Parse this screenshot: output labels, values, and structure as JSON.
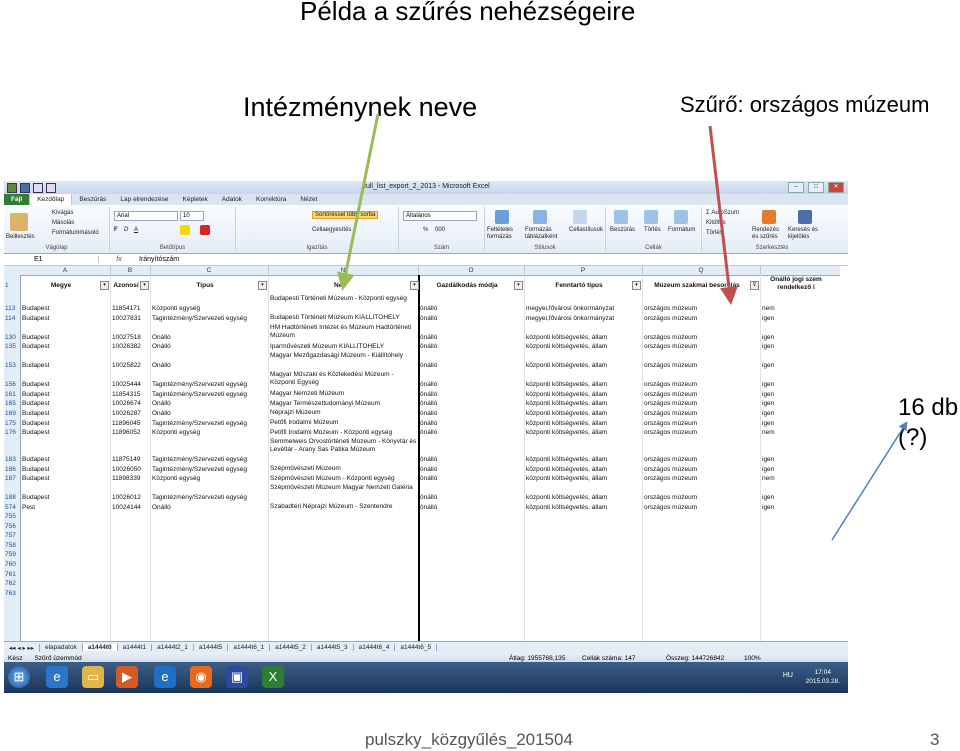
{
  "slide": {
    "title": "Példa a szűrés nehézségeire",
    "annotation_name": "Intézménynek neve",
    "annotation_filter": "Szűrő: országos múzeum",
    "annotation_count_line1": "16 db",
    "annotation_count_line2": "(?)",
    "footer": "pulszky_közgyűlés_201504",
    "page_number": "3"
  },
  "window": {
    "title": "full_list_export_2_2013 - Microsoft Excel"
  },
  "ribbon": {
    "tabs": [
      "Fájl",
      "Kezdőlap",
      "Beszúrás",
      "Lap elrendezése",
      "Képletek",
      "Adatok",
      "Korrektúra",
      "Nézet"
    ],
    "clipboard": {
      "paste": "Beillesztés",
      "cut": "Kivágás",
      "copy": "Másolás",
      "format_painter": "Formátummásoló",
      "label": "Vágólap"
    },
    "font": {
      "name": "Arial",
      "size": "10",
      "label": "Betűtípus"
    },
    "alignment": {
      "wrap": "Sortöréssel több sorba",
      "merge": "Cellaegyesítés",
      "label": "Igazítás"
    },
    "number": {
      "format": "Általános",
      "percent": "%",
      "thousands": "000",
      "label": "Szám"
    },
    "styles": {
      "conditional": "Feltételes formázás",
      "as_table": "Formázás táblázatként",
      "cell_styles": "Cellastílusok",
      "label": "Stílusok"
    },
    "cells": {
      "insert": "Beszúrás",
      "delete": "Törlés",
      "format": "Formátum",
      "label": "Cellák"
    },
    "editing": {
      "autosum": "AutoSzum",
      "fill": "Kitöltés",
      "clear": "Törlés",
      "sort": "Rendezés és szűrés",
      "find": "Keresés és kijelölés",
      "label": "Szerkesztés"
    }
  },
  "formula_bar": {
    "name_box": "E1",
    "fx": "fx",
    "content": "Irányítószám"
  },
  "columns": [
    "A",
    "B",
    "C",
    "N",
    "O",
    "P",
    "Q"
  ],
  "header_row": {
    "row": "1",
    "cells": [
      "Megye",
      "Azonosí",
      "Típus",
      "Név",
      "Gazdálkodás módja",
      "Fenntartó típus",
      "Múzeum szakmai besorolás",
      "Önálló jogi szem rendelkező i"
    ]
  },
  "rows": [
    {
      "row": "113",
      "megye": "Budapest",
      "azon": "11854171",
      "tipus": "Központi egység",
      "nev": "Budapesti Történeti Múzeum - Központi egység",
      "gazd": "önálló",
      "fenn": "megyei,fővárosi önkormányzat",
      "besor": "országos múzeum",
      "onallo": "nem"
    },
    {
      "row": "114",
      "megye": "Budapest",
      "azon": "10027831",
      "tipus": "Tagintézmény/Szervezeti egység",
      "nev": "Budapesti Történeti Múzeum KIÁLLÍTÓHELY",
      "gazd": "önálló",
      "fenn": "megyei,fővárosi önkormányzat",
      "besor": "országos múzeum",
      "onallo": "igen"
    },
    {
      "row": "130",
      "megye": "Budapest",
      "azon": "10027518",
      "tipus": "Önálló",
      "nev": "HM Hadtörténeti Intézet és Múzeum Hadtörténeti Múzeum",
      "gazd": "önálló",
      "fenn": "központi költségvetés, állam",
      "besor": "országos múzeum",
      "onallo": "igen"
    },
    {
      "row": "135",
      "megye": "Budapest",
      "azon": "10026382",
      "tipus": "Önálló",
      "nev": "Iparművészeti Múzeum KIÁLLÍTÓHELY",
      "gazd": "önálló",
      "fenn": "központi költségvetés, állam",
      "besor": "országos múzeum",
      "onallo": "igen"
    },
    {
      "row": "153",
      "megye": "Budapest",
      "azon": "10025822",
      "tipus": "Önálló",
      "nev": "Magyar Mezőgazdasági Múzeum - Kiállítóhely",
      "gazd": "önálló",
      "fenn": "központi költségvetés, állam",
      "besor": "országos múzeum",
      "onallo": "igen"
    },
    {
      "row": "156",
      "megye": "Budapest",
      "azon": "10025444",
      "tipus": "Tagintézmény/Szervezeti egység",
      "nev": "Magyar Műszaki és Közlekedési Múzeum - Központi Egység",
      "gazd": "önálló",
      "fenn": "központi költségvetés, állam",
      "besor": "országos múzeum",
      "onallo": "igen"
    },
    {
      "row": "161",
      "megye": "Budapest",
      "azon": "11854315",
      "tipus": "Tagintézmény/Szervezeti egység",
      "nev": "Magyar Nemzeti Múzeum",
      "gazd": "önálló",
      "fenn": "központi költségvetés, állam",
      "besor": "országos múzeum",
      "onallo": "igen"
    },
    {
      "row": "165",
      "megye": "Budapest",
      "azon": "10026674",
      "tipus": "Önálló",
      "nev": "Magyar Természettudományi Múzeum",
      "gazd": "önálló",
      "fenn": "központi költségvetés, állam",
      "besor": "országos múzeum",
      "onallo": "igen"
    },
    {
      "row": "169",
      "megye": "Budapest",
      "azon": "10026287",
      "tipus": "Önálló",
      "nev": "Néprajzi Múzeum",
      "gazd": "önálló",
      "fenn": "központi költségvetés, állam",
      "besor": "országos múzeum",
      "onallo": "igen"
    },
    {
      "row": "175",
      "megye": "Budapest",
      "azon": "11896045",
      "tipus": "Tagintézmény/Szervezeti egység",
      "nev": "Petőfi Irodalmi Múzeum",
      "gazd": "önálló",
      "fenn": "központi költségvetés, állam",
      "besor": "országos múzeum",
      "onallo": "igen"
    },
    {
      "row": "176",
      "megye": "Budapest",
      "azon": "11896052",
      "tipus": "Központi egység",
      "nev": "Petőfi Irodalmi Múzeum - Központi egység",
      "gazd": "önálló",
      "fenn": "központi költségvetés, állam",
      "besor": "országos múzeum",
      "onallo": "nem"
    },
    {
      "row": "183",
      "megye": "Budapest",
      "azon": "11875149",
      "tipus": "Tagintézmény/Szervezeti egység",
      "nev": "Semmelweis Orvostörténeti Múzeum - Könyvtár és Levéltár - Arany Sas Patika Múzeum",
      "gazd": "önálló",
      "fenn": "központi költségvetés, állam",
      "besor": "országos múzeum",
      "onallo": "igen"
    },
    {
      "row": "186",
      "megye": "Budapest",
      "azon": "10026050",
      "tipus": "Tagintézmény/Szervezeti egység",
      "nev": "Szépművészeti Múzeum",
      "gazd": "önálló",
      "fenn": "központi költségvetés, állam",
      "besor": "országos múzeum",
      "onallo": "igen"
    },
    {
      "row": "187",
      "megye": "Budapest",
      "azon": "11898339",
      "tipus": "Központi egység",
      "nev": "Szépművészeti Múzeum - Központi egység",
      "gazd": "önálló",
      "fenn": "központi költségvetés, állam",
      "besor": "országos múzeum",
      "onallo": "nem"
    },
    {
      "row": "188",
      "megye": "Budapest",
      "azon": "10026012",
      "tipus": "Tagintézmény/Szervezeti egység",
      "nev": "Szépművészeti Múzeum Magyar Nemzeti Galéria",
      "gazd": "önálló",
      "fenn": "központi költségvetés, állam",
      "besor": "országos múzeum",
      "onallo": "igen"
    },
    {
      "row": "574",
      "megye": "Pest",
      "azon": "10024144",
      "tipus": "Önálló",
      "nev": "Szabadtéri Néprajzi Múzeum - Szentendre",
      "gazd": "önálló",
      "fenn": "központi költségvetés, állam",
      "besor": "országos múzeum",
      "onallo": "igen"
    }
  ],
  "empty_rows": [
    "755",
    "756",
    "757",
    "758",
    "759",
    "760",
    "761",
    "762",
    "763"
  ],
  "sheets": [
    "elapadatok",
    "a1444t0",
    "a1444t1",
    "a1444t2_1",
    "a1444t5",
    "a1444t6_1",
    "a1444t5_2",
    "a1444t5_3",
    "a1444t6_4",
    "a1444t6_5"
  ],
  "active_sheet": "a1444t0",
  "status": {
    "mode": "Kész",
    "filter_mode": "Szűrő üzemmód",
    "average": "Átlag: 1955768,135",
    "count": "Cellák száma: 147",
    "sum": "Összeg: 144726842",
    "zoom": "100%"
  },
  "taskbar": {
    "language": "HU",
    "time": "17:04",
    "date": "2015.03.28."
  }
}
